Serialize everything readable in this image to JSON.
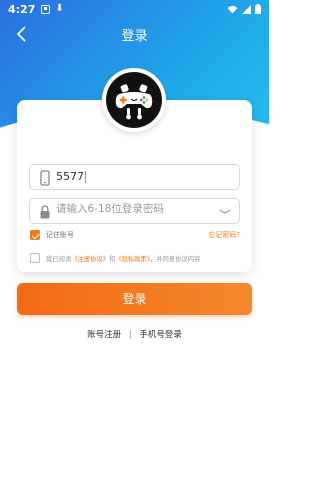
{
  "status_bar": {
    "time": "4:27"
  },
  "header": {
    "title": "登录"
  },
  "login_form": {
    "phone_value": "5577",
    "password_placeholder": "请输入6-18位登录密码",
    "remember_label": "记住账号",
    "remember_checked": true,
    "forgot_label": "忘记密码?",
    "agreement": {
      "checked": false,
      "prefix": "我已阅读",
      "user_agreement": "《注册协议》",
      "and": "和",
      "privacy_policy": "《隐私政策》",
      "suffix": "，并同意协议内容"
    }
  },
  "login_button": {
    "label": "登录"
  },
  "bottom_links": {
    "register": "账号注册",
    "separator": "|",
    "phone_login": "手机号登录"
  },
  "colors": {
    "accent": "#f07c22",
    "header_start": "#2b6fe0",
    "header_end": "#2bc3ef"
  },
  "icons": {
    "back": "chevron-left-icon",
    "phone": "phone-icon",
    "lock": "lock-icon",
    "eye": "eye-closed-icon"
  }
}
